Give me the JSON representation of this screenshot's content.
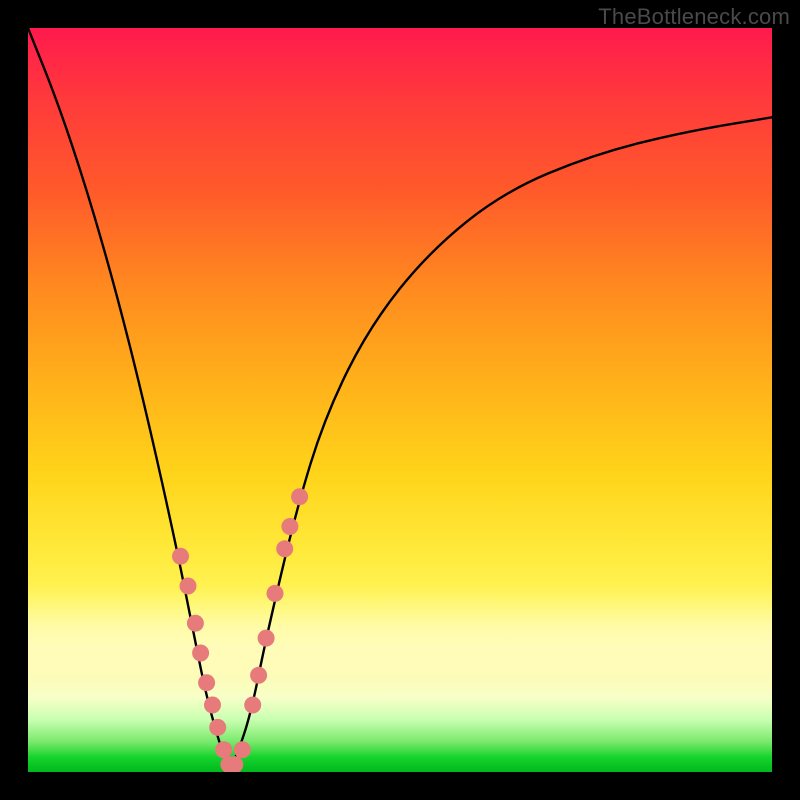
{
  "watermark": "TheBottleneck.com",
  "colors": {
    "frame": "#000000",
    "curve": "#000000",
    "dot_fill": "#e77a7a",
    "dot_stroke": "#d46a6a"
  },
  "chart_data": {
    "type": "line",
    "title": "",
    "xlabel": "",
    "ylabel": "",
    "xlim": [
      0,
      100
    ],
    "ylim": [
      0,
      100
    ],
    "note": "Axes have no visible tick labels; values are normalized 0–100 estimates read from the figure. y=0 at bottom (green), y=100 at top (red). Curve is a V-shaped bottleneck plot with minimum near x≈27.",
    "series": [
      {
        "name": "bottleneck-curve",
        "x": [
          0,
          4,
          8,
          12,
          16,
          20,
          22,
          24,
          26,
          27,
          28,
          30,
          32,
          36,
          40,
          46,
          54,
          64,
          76,
          88,
          100
        ],
        "y": [
          100,
          90,
          78,
          64,
          48,
          30,
          20,
          10,
          3,
          0.5,
          2,
          8,
          18,
          35,
          48,
          60,
          70,
          78,
          83,
          86,
          88
        ]
      }
    ],
    "scatter": {
      "name": "highlight-dots",
      "note": "Salmon-colored dots clustered along the lower V of the curve.",
      "points": [
        {
          "x": 20.5,
          "y": 29
        },
        {
          "x": 21.5,
          "y": 25
        },
        {
          "x": 22.5,
          "y": 20
        },
        {
          "x": 23.2,
          "y": 16
        },
        {
          "x": 24.0,
          "y": 12
        },
        {
          "x": 24.8,
          "y": 9
        },
        {
          "x": 25.5,
          "y": 6
        },
        {
          "x": 26.3,
          "y": 3
        },
        {
          "x": 27.0,
          "y": 1
        },
        {
          "x": 27.8,
          "y": 1
        },
        {
          "x": 28.8,
          "y": 3
        },
        {
          "x": 30.2,
          "y": 9
        },
        {
          "x": 31.0,
          "y": 13
        },
        {
          "x": 32.0,
          "y": 18
        },
        {
          "x": 33.2,
          "y": 24
        },
        {
          "x": 34.5,
          "y": 30
        },
        {
          "x": 35.2,
          "y": 33
        },
        {
          "x": 36.5,
          "y": 37
        }
      ]
    }
  }
}
